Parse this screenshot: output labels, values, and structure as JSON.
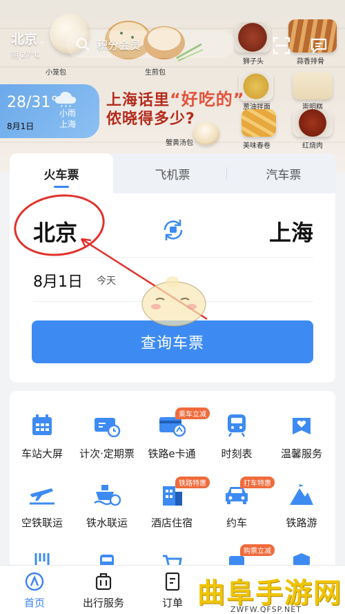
{
  "header": {
    "city": "北京",
    "weather_line": "阴 27°C",
    "search_placeholder": "积分会员"
  },
  "weather_card": {
    "temp_range": "28/31°",
    "date": "8月1日",
    "condition": "小雨",
    "city": "上海"
  },
  "banner": {
    "title_a": "上海话里",
    "title_hl": "“好吃的”",
    "title_b": "侬晓得多少?",
    "foods": [
      "小笼包",
      "生煎包",
      "狮子头",
      "蒜香排骨",
      "葱油拌面",
      "崇明糕",
      "蟹黄汤包",
      "美味春卷",
      "红烧肉"
    ]
  },
  "ticket_tabs": [
    "火车票",
    "飞机票",
    "汽车票"
  ],
  "booking": {
    "from": "北京",
    "to": "上海",
    "date": "8月1日",
    "day_label": "今天",
    "query_button": "查询车票"
  },
  "services": [
    {
      "label": "车站大屏",
      "icon": "station-board-icon",
      "badge": ""
    },
    {
      "label": "计次·定期票",
      "icon": "ticket-pass-icon",
      "badge": ""
    },
    {
      "label": "铁路e卡通",
      "icon": "e-card-icon",
      "badge": "乘车立减"
    },
    {
      "label": "时刻表",
      "icon": "timetable-train-icon",
      "badge": ""
    },
    {
      "label": "温馨服务",
      "icon": "heart-service-icon",
      "badge": ""
    },
    {
      "label": "空铁联运",
      "icon": "air-rail-icon",
      "badge": ""
    },
    {
      "label": "铁水联运",
      "icon": "ship-rail-icon",
      "badge": ""
    },
    {
      "label": "酒店住宿",
      "icon": "hotel-icon",
      "badge": "铁路特惠"
    },
    {
      "label": "约车",
      "icon": "car-icon",
      "badge": "打车特惠"
    },
    {
      "label": "铁路游",
      "icon": "mountain-travel-icon",
      "badge": ""
    }
  ],
  "more_services_badge": "购票立减",
  "bottom_nav": [
    {
      "label": "首页",
      "icon": "home-icon",
      "active": true
    },
    {
      "label": "出行服务",
      "icon": "luggage-icon",
      "active": false
    },
    {
      "label": "订单",
      "icon": "order-icon",
      "active": false
    }
  ],
  "watermark": {
    "text": "曲阜手游网",
    "url": "ZWFW.QFSP.NET"
  },
  "colors": {
    "accent": "#3d8bf2",
    "annotation": "#e0312a",
    "badge": "#f06a3b"
  }
}
